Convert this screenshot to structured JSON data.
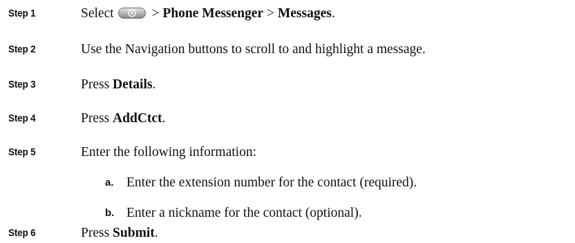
{
  "steps": [
    {
      "label": "Step 1",
      "prefix": "Select",
      "icon": "settings-button-icon",
      "sep1": " > ",
      "item1": "Phone Messenger",
      "sep2": " > ",
      "item2": "Messages",
      "suffix": "."
    },
    {
      "label": "Step 2",
      "text": "Use the Navigation buttons to scroll to and highlight a message."
    },
    {
      "label": "Step 3",
      "prefix": "Press ",
      "bold": "Details",
      "suffix": "."
    },
    {
      "label": "Step 4",
      "prefix": "Press ",
      "bold": "AddCtct",
      "suffix": "."
    },
    {
      "label": "Step 5",
      "text": "Enter the following information:",
      "substeps": [
        {
          "letter": "a.",
          "text": "Enter the extension number for the contact (required)."
        },
        {
          "letter": "b.",
          "text": "Enter a nickname for the contact (optional)."
        }
      ]
    },
    {
      "label": "Step 6",
      "prefix": "Press ",
      "bold": "Submit",
      "suffix": "."
    }
  ]
}
